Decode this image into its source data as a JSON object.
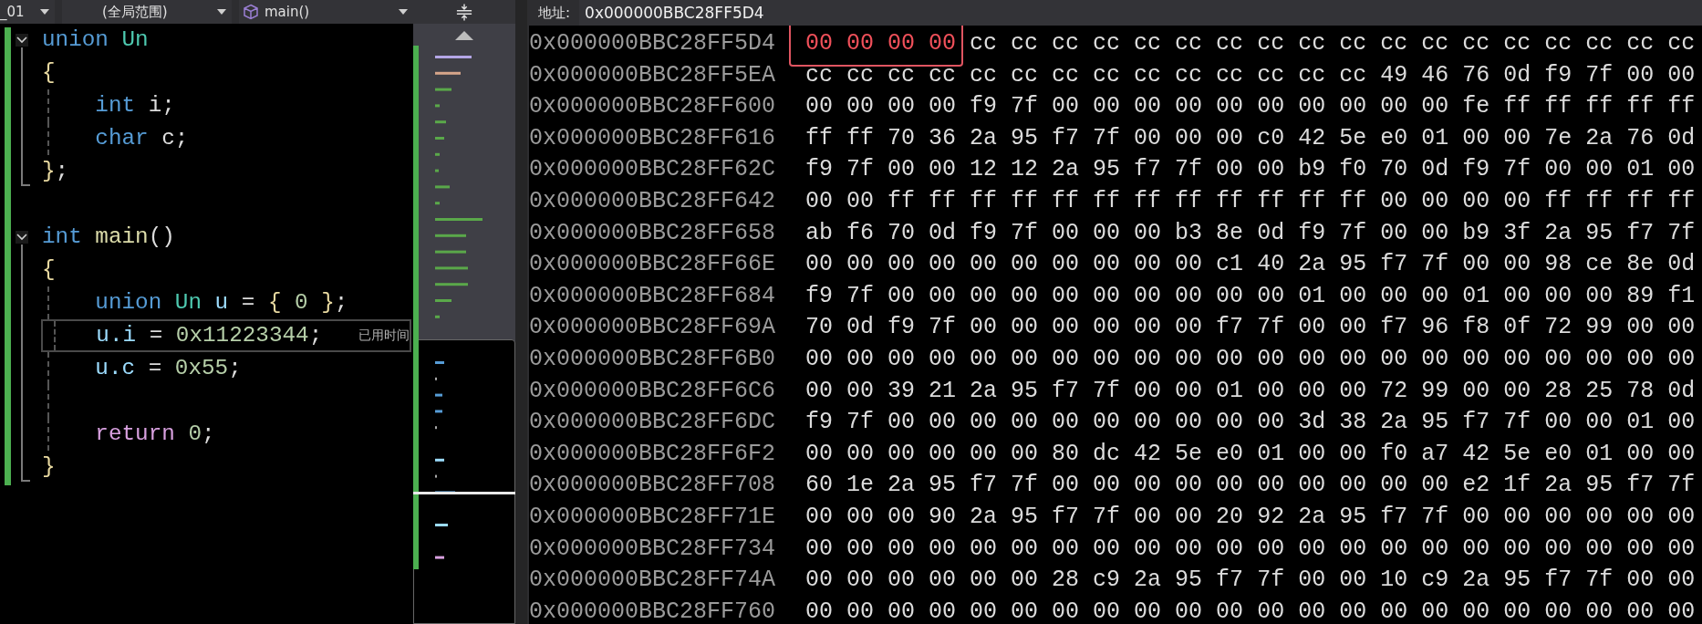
{
  "editor": {
    "navigation": [
      {
        "label": "_01",
        "kind": "project"
      },
      {
        "label": "(全局范围)",
        "kind": "scope"
      },
      {
        "label": "main()",
        "kind": "member"
      }
    ],
    "lines": [
      {
        "kind": "fold-start",
        "current": false,
        "tokens": [
          {
            "text": "union",
            "kind": "keyword"
          },
          {
            "text": " Un",
            "kind": "type"
          }
        ]
      },
      {
        "kind": "fold-brace",
        "current": false,
        "tokens": [
          {
            "text": "{",
            "kind": "brace"
          }
        ]
      },
      {
        "kind": "fold-body",
        "current": false,
        "tokens": [
          {
            "text": "    int",
            "kind": "keyword"
          },
          {
            "text": " i;",
            "kind": "plain"
          }
        ]
      },
      {
        "kind": "fold-body",
        "current": false,
        "tokens": [
          {
            "text": "    char",
            "kind": "keyword"
          },
          {
            "text": " c;",
            "kind": "plain"
          }
        ]
      },
      {
        "kind": "fold-end",
        "current": false,
        "tokens": [
          {
            "text": "}",
            "kind": "brace"
          },
          {
            "text": ";",
            "kind": "plain"
          }
        ]
      },
      {
        "kind": "blank",
        "current": false
      },
      {
        "kind": "fold-start",
        "current": false,
        "tokens": [
          {
            "text": "int",
            "kind": "keyword"
          },
          {
            "text": " main",
            "kind": "func"
          },
          {
            "text": "()",
            "kind": "plain"
          }
        ]
      },
      {
        "kind": "fold-brace",
        "current": false,
        "tokens": [
          {
            "text": "{",
            "kind": "brace"
          }
        ]
      },
      {
        "kind": "fold-body",
        "current": false,
        "tokens": [
          {
            "text": "    union",
            "kind": "keyword"
          },
          {
            "text": " Un",
            "kind": "type"
          },
          {
            "text": " u",
            "kind": "var"
          },
          {
            "text": " =",
            "kind": "plain"
          },
          {
            "text": " {",
            "kind": "brace"
          },
          {
            "text": " 0",
            "kind": "num"
          },
          {
            "text": " }",
            "kind": "brace"
          },
          {
            "text": ";",
            "kind": "plain"
          }
        ]
      },
      {
        "kind": "fold-body",
        "current": true,
        "hint": "已用时间",
        "tokens": [
          {
            "text": "    u.i",
            "kind": "var"
          },
          {
            "text": " =",
            "kind": "plain"
          },
          {
            "text": " 0x11223344",
            "kind": "num"
          },
          {
            "text": ";",
            "kind": "plain"
          }
        ]
      },
      {
        "kind": "fold-body",
        "current": false,
        "tokens": [
          {
            "text": "    u.c",
            "kind": "var"
          },
          {
            "text": " =",
            "kind": "plain"
          },
          {
            "text": " 0x55",
            "kind": "num"
          },
          {
            "text": ";",
            "kind": "plain"
          }
        ]
      },
      {
        "kind": "fold-body",
        "current": false
      },
      {
        "kind": "fold-body",
        "current": false,
        "tokens": [
          {
            "text": "    return",
            "kind": "control"
          },
          {
            "text": " 0",
            "kind": "num"
          },
          {
            "text": ";",
            "kind": "plain"
          }
        ]
      },
      {
        "kind": "fold-end",
        "current": false,
        "tokens": [
          {
            "text": "}",
            "kind": "brace"
          }
        ]
      }
    ]
  },
  "memory": {
    "address_label": "地址:",
    "address": "0x000000BBC28FF5D4",
    "rows": [
      {
        "address": "0x000000BBC28FF5D4",
        "changed": "00 00 00 00",
        "bytes": "cc cc cc cc cc cc cc cc cc cc cc cc cc cc cc cc cc cc"
      },
      {
        "address": "0x000000BBC28FF5EA",
        "bytes": "cc cc cc cc cc cc cc cc cc cc cc cc cc cc 49 46 76 0d f9 7f 00 00"
      },
      {
        "address": "0x000000BBC28FF600",
        "bytes": "00 00 00 00 f9 7f 00 00 00 00 00 00 00 00 00 00 fe ff ff ff ff ff"
      },
      {
        "address": "0x000000BBC28FF616",
        "bytes": "ff ff 70 36 2a 95 f7 7f 00 00 00 c0 42 5e e0 01 00 00 7e 2a 76 0d"
      },
      {
        "address": "0x000000BBC28FF62C",
        "bytes": "f9 7f 00 00 12 12 2a 95 f7 7f 00 00 b9 f0 70 0d f9 7f 00 00 01 00"
      },
      {
        "address": "0x000000BBC28FF642",
        "bytes": "00 00 ff ff ff ff ff ff ff ff ff ff ff ff 00 00 00 00 ff ff ff ff"
      },
      {
        "address": "0x000000BBC28FF658",
        "bytes": "ab f6 70 0d f9 7f 00 00 00 b3 8e 0d f9 7f 00 00 b9 3f 2a 95 f7 7f"
      },
      {
        "address": "0x000000BBC28FF66E",
        "bytes": "00 00 00 00 00 00 00 00 00 00 c1 40 2a 95 f7 7f 00 00 98 ce 8e 0d"
      },
      {
        "address": "0x000000BBC28FF684",
        "bytes": "f9 7f 00 00 00 00 00 00 00 00 00 00 01 00 00 00 01 00 00 00 89 f1"
      },
      {
        "address": "0x000000BBC28FF69A",
        "bytes": "70 0d f9 7f 00 00 00 00 00 00 f7 7f 00 00 f7 96 f8 0f 72 99 00 00"
      },
      {
        "address": "0x000000BBC28FF6B0",
        "bytes": "00 00 00 00 00 00 00 00 00 00 00 00 00 00 00 00 00 00 00 00 00 00"
      },
      {
        "address": "0x000000BBC28FF6C6",
        "bytes": "00 00 39 21 2a 95 f7 7f 00 00 01 00 00 00 72 99 00 00 28 25 78 0d"
      },
      {
        "address": "0x000000BBC28FF6DC",
        "bytes": "f9 7f 00 00 00 00 00 00 00 00 00 00 3d 38 2a 95 f7 7f 00 00 01 00"
      },
      {
        "address": "0x000000BBC28FF6F2",
        "bytes": "00 00 00 00 00 00 80 dc 42 5e e0 01 00 00 f0 a7 42 5e e0 01 00 00"
      },
      {
        "address": "0x000000BBC28FF708",
        "bytes": "60 1e 2a 95 f7 7f 00 00 00 00 00 00 00 00 00 00 e2 1f 2a 95 f7 7f"
      },
      {
        "address": "0x000000BBC28FF71E",
        "bytes": "00 00 00 90 2a 95 f7 7f 00 00 20 92 2a 95 f7 7f 00 00 00 00 00 00"
      },
      {
        "address": "0x000000BBC28FF734",
        "bytes": "00 00 00 00 00 00 00 00 00 00 00 00 00 00 00 00 00 00 00 00 00 00"
      },
      {
        "address": "0x000000BBC28FF74A",
        "bytes": "00 00 00 00 00 00 28 c9 2a 95 f7 7f 00 00 10 c9 2a 95 f7 7f 00 00"
      },
      {
        "address": "0x000000BBC28FF760",
        "bytes": "00 00 00 00 00 00 00 00 00 00 00 00 00 00 00 00 00 00 00 00 00 00"
      }
    ]
  }
}
